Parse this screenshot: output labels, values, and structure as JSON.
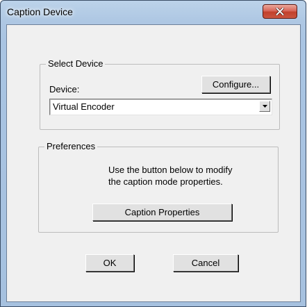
{
  "window": {
    "title": "Caption Device",
    "close_icon": "close-icon"
  },
  "select_device": {
    "group_label": "Select Device",
    "device_label": "Device:",
    "configure_label": "Configure...",
    "device_value": "Virtual Encoder",
    "dropdown_icon": "chevron-down-icon"
  },
  "preferences": {
    "group_label": "Preferences",
    "description_line1": "Use the button below to modify",
    "description_line2": "the caption mode properties.",
    "caption_properties_label": "Caption Properties"
  },
  "footer": {
    "ok_label": "OK",
    "cancel_label": "Cancel"
  }
}
